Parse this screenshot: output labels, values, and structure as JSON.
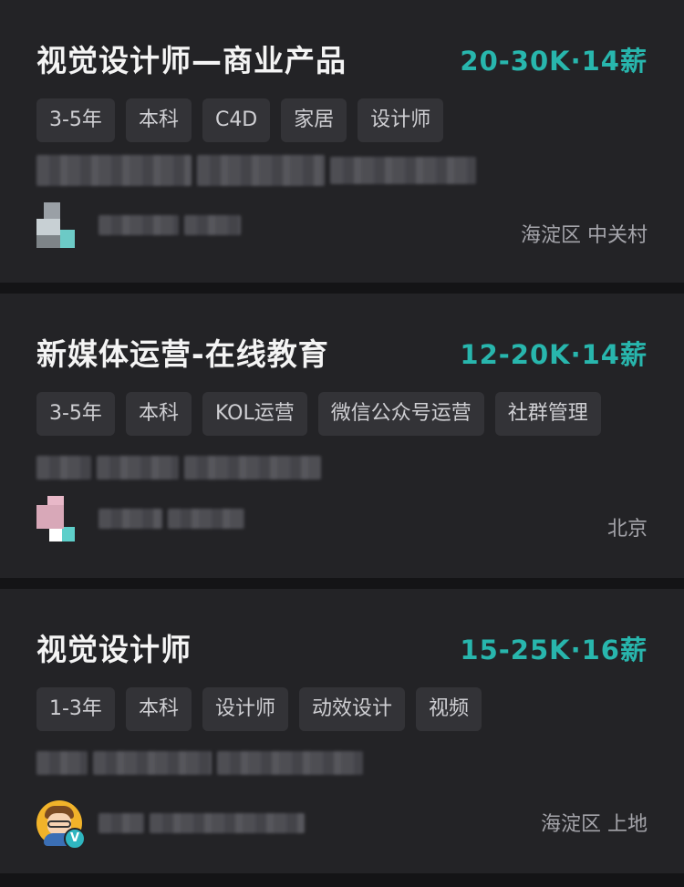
{
  "jobs": [
    {
      "title": "视觉设计师—商业产品",
      "salary": "20-30K·14薪",
      "tags": [
        "3-5年",
        "本科",
        "C4D",
        "家居",
        "设计师"
      ],
      "location": "海淀区 中关村"
    },
    {
      "title": "新媒体运营-在线教育",
      "salary": "12-20K·14薪",
      "tags": [
        "3-5年",
        "本科",
        "KOL运营",
        "微信公众号运营",
        "社群管理"
      ],
      "location": "北京"
    },
    {
      "title": "视觉设计师",
      "salary": "15-25K·16薪",
      "tags": [
        "1-3年",
        "本科",
        "设计师",
        "动效设计",
        "视频"
      ],
      "location": "海淀区 上地",
      "verified_badge": "V"
    }
  ],
  "colors": {
    "background": "#141416",
    "card": "#232326",
    "salary": "#28b6ad",
    "tag_bg": "#333337"
  }
}
